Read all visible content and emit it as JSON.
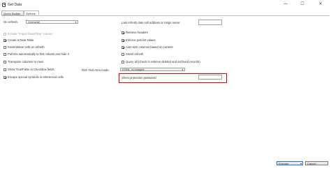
{
  "window": {
    "title": "Get Data",
    "minimize": "—",
    "maximize": "☐",
    "close": "✕"
  },
  "tabs": [
    {
      "label": "Query Builder"
    },
    {
      "label": "Options"
    }
  ],
  "on_refresh": {
    "label": "On refresh:",
    "value": "Overwrite"
  },
  "left_options": [
    {
      "label": "Include \"Import Date/Time\" column",
      "checked": false,
      "disabled": true
    },
    {
      "label": "Create a Data Table",
      "checked": true
    },
    {
      "label": "Insert/delete cells on refresh",
      "checked": false
    },
    {
      "label": "Pull IDs automatically to first column and hide it",
      "checked": false
    },
    {
      "label": "Transpose columns to rows",
      "checked": false
    },
    {
      "label": "Show True/False in Checkbox fields",
      "checked": false
    },
    {
      "label": "Escape special symbols in referenced cells",
      "checked": true
    }
  ],
  "last_refresh": {
    "label": "Last refresh date cell address or range name:",
    "value": ""
  },
  "right_options": [
    {
      "label": "Retrieve headers",
      "checked": true
    },
    {
      "label": "Enforce pick list values",
      "checked": true
    },
    {
      "label": "Auto-size columns based on content",
      "checked": true
    },
    {
      "label": "Smart refresh",
      "checked": false
    },
    {
      "label": "Query all (check to retrieve deleted and archived records)",
      "checked": false
    }
  ],
  "rich_text": {
    "label": "Rich Text Area mode:",
    "value": "HTML, no images"
  },
  "sheet_password": {
    "label": "Sheet protection password",
    "value": ""
  },
  "execute_button": {
    "label": "Execute",
    "dropdown": "▾"
  },
  "cancel_button": {
    "label": "Cancel"
  }
}
